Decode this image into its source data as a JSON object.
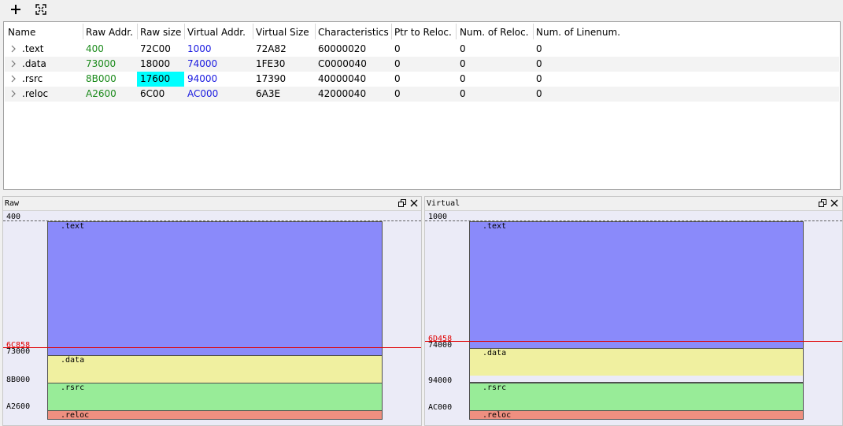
{
  "toolbar": {
    "add_icon": "plus-icon",
    "fit_icon": "fit-screen-icon"
  },
  "table": {
    "columns": [
      "Name",
      "Raw Addr.",
      "Raw size",
      "Virtual Addr.",
      "Virtual Size",
      "Characteristics",
      "Ptr to Reloc.",
      "Num. of Reloc.",
      "Num. of Linenum."
    ],
    "rows": [
      {
        "name": ".text",
        "raw_addr": "400",
        "raw_size": "72C00",
        "virt_addr": "1000",
        "virt_size": "72A82",
        "characteristics": "60000020",
        "ptr_reloc": "0",
        "num_reloc": "0",
        "num_linenum": "0"
      },
      {
        "name": ".data",
        "raw_addr": "73000",
        "raw_size": "18000",
        "virt_addr": "74000",
        "virt_size": "1FE30",
        "characteristics": "C0000040",
        "ptr_reloc": "0",
        "num_reloc": "0",
        "num_linenum": "0"
      },
      {
        "name": ".rsrc",
        "raw_addr": "8B000",
        "raw_size": "17600",
        "virt_addr": "94000",
        "virt_size": "17390",
        "characteristics": "40000040",
        "ptr_reloc": "0",
        "num_reloc": "0",
        "num_linenum": "0"
      },
      {
        "name": ".reloc",
        "raw_addr": "A2600",
        "raw_size": "6C00",
        "virt_addr": "AC000",
        "virt_size": "6A3E",
        "characteristics": "42000040",
        "ptr_reloc": "0",
        "num_reloc": "0",
        "num_linenum": "0"
      }
    ],
    "selected_cell": "rsrc.raw_size"
  },
  "raw_view": {
    "title": "Raw",
    "top_addr": "400",
    "cursor_addr": "6C858",
    "addrs": [
      "73000",
      "8B000",
      "A2600"
    ],
    "sections": [
      ".text",
      ".data",
      ".rsrc",
      ".reloc"
    ]
  },
  "virtual_view": {
    "title": "Virtual",
    "top_addr": "1000",
    "cursor_addr": "6D458",
    "addrs": [
      "74000",
      "94000",
      "AC000"
    ],
    "sections": [
      ".text",
      ".data",
      ".rsrc",
      ".reloc"
    ]
  },
  "colors": {
    "text": "#8a8afa",
    "data": "#f0f0a0",
    "rsrc": "#98ec98",
    "reloc": "#ee8f80",
    "cursor": "#e00000"
  }
}
